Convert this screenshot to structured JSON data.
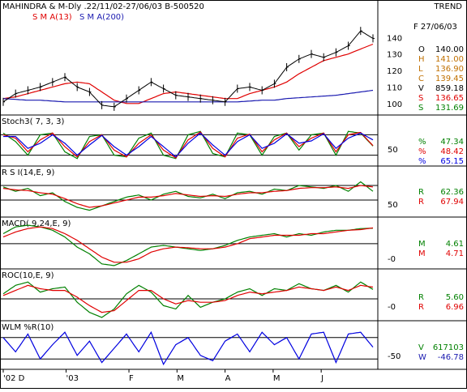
{
  "header": {
    "title": "MAHINDRA & M-Dly .22/11/02-27/06/03  B-500520",
    "mode": "TREND",
    "sma13_label": "S M A(13)",
    "sma200_label": "S M A(200)"
  },
  "colors": {
    "price": "#000000",
    "sma13": "#e00000",
    "sma200": "#1a1ab0",
    "green": "#008000",
    "red": "#e00000",
    "blue": "#0000e0",
    "orange": "#c07000"
  },
  "price_panel": {
    "date_label": "F 27/06/03",
    "ticks": [
      "140",
      "130",
      "120",
      "110",
      "100"
    ],
    "stats": [
      {
        "key": "O",
        "value": "140.00",
        "color": "#000000"
      },
      {
        "key": "H",
        "value": "141.00",
        "color": "#c07000"
      },
      {
        "key": "L",
        "value": "136.90",
        "color": "#c07000"
      },
      {
        "key": "C",
        "value": "139.45",
        "color": "#c07000"
      },
      {
        "key": "V",
        "value": "859.18",
        "color": "#000000"
      },
      {
        "key": "S",
        "value": "136.65",
        "color": "#e00000"
      },
      {
        "key": "S",
        "value": "131.69",
        "color": "#008000"
      }
    ]
  },
  "stoch_panel": {
    "label": "Stoch3( 7, 3, 3)",
    "tick": "50",
    "values": [
      {
        "key": "%",
        "value": "47.34",
        "color": "#008000"
      },
      {
        "key": "%",
        "value": "48.42",
        "color": "#e00000"
      },
      {
        "key": "%",
        "value": "65.15",
        "color": "#0000e0"
      }
    ]
  },
  "rsi_panel": {
    "label": "R S I(14,E, 9)",
    "tick": "50",
    "values": [
      {
        "key": "R",
        "value": "62.36",
        "color": "#008000"
      },
      {
        "key": "R",
        "value": "67.94",
        "color": "#e00000"
      }
    ]
  },
  "macd_panel": {
    "label": "MACD( 9,24,E, 9)",
    "tick": "-0",
    "values": [
      {
        "key": "M",
        "value": "4.61",
        "color": "#008000"
      },
      {
        "key": "M",
        "value": "4.71",
        "color": "#e00000"
      }
    ]
  },
  "roc_panel": {
    "label": "ROC(10,E, 9)",
    "tick": "-0",
    "values": [
      {
        "key": "R",
        "value": "5.60",
        "color": "#008000"
      },
      {
        "key": "R",
        "value": "6.96",
        "color": "#e00000"
      }
    ]
  },
  "wlm_panel": {
    "label": "WLM %R(10)",
    "tick": "-50",
    "values": [
      {
        "key": "V",
        "value": "617103",
        "color": "#008000"
      },
      {
        "key": "W",
        "value": "-46.78",
        "color": "#1a1ab0"
      }
    ]
  },
  "x_axis": [
    "'02 D",
    "'03",
    "F",
    "M",
    "A",
    "M",
    "J"
  ],
  "chart_data": [
    {
      "type": "line",
      "panel": "price",
      "x_range": [
        "22/11/02",
        "27/06/03"
      ],
      "ylim": [
        95,
        148
      ],
      "series": [
        {
          "name": "S M A(13)",
          "color": "#e00000",
          "values": [
            103,
            104,
            106,
            108,
            110,
            112,
            113,
            112,
            107,
            102,
            100,
            100,
            103,
            106,
            107,
            106,
            105,
            104,
            103,
            103,
            106,
            108,
            110,
            113,
            118,
            122,
            126,
            128,
            130,
            133,
            136
          ]
        },
        {
          "name": "S M A(200)",
          "color": "#1a1ab0",
          "values": [
            103,
            102.5,
            102,
            102,
            101.5,
            101,
            101,
            101,
            101,
            101,
            101,
            101,
            101,
            101,
            101,
            101,
            101,
            101,
            101,
            101,
            101.5,
            102,
            102,
            103,
            103.5,
            104,
            104.5,
            105,
            106,
            107,
            108
          ]
        },
        {
          "name": "close",
          "color": "#000000",
          "values": [
            101,
            106,
            108,
            110,
            113,
            116,
            110,
            107,
            99,
            98,
            103,
            108,
            113,
            109,
            105,
            104,
            103,
            102,
            101,
            109,
            110,
            108,
            112,
            122,
            127,
            130,
            128,
            131,
            135,
            144,
            139.45
          ]
        }
      ]
    },
    {
      "type": "line",
      "panel": "stoch",
      "ylim": [
        0,
        100
      ],
      "series": [
        {
          "name": "",
          "color": "#008000",
          "values": [
            85,
            60,
            20,
            80,
            85,
            30,
            10,
            75,
            80,
            20,
            15,
            70,
            85,
            20,
            10,
            80,
            90,
            25,
            15,
            85,
            80,
            20,
            75,
            85,
            35,
            80,
            85,
            20,
            90,
            85,
            47
          ]
        },
        {
          "name": "",
          "color": "#e00000",
          "values": [
            80,
            70,
            30,
            65,
            85,
            45,
            15,
            60,
            80,
            35,
            15,
            55,
            80,
            35,
            12,
            65,
            88,
            40,
            15,
            70,
            82,
            30,
            65,
            85,
            45,
            70,
            85,
            30,
            80,
            87,
            48
          ]
        },
        {
          "name": "",
          "color": "#0000e0",
          "values": [
            75,
            75,
            40,
            55,
            80,
            55,
            20,
            50,
            78,
            45,
            20,
            45,
            75,
            45,
            15,
            55,
            85,
            50,
            20,
            60,
            80,
            40,
            55,
            83,
            55,
            62,
            83,
            40,
            70,
            85,
            65
          ]
        }
      ]
    },
    {
      "type": "line",
      "panel": "rsi",
      "ylim": [
        30,
        80
      ],
      "series": [
        {
          "name": "",
          "color": "#008000",
          "values": [
            68,
            62,
            66,
            56,
            60,
            48,
            40,
            36,
            42,
            48,
            54,
            57,
            50,
            58,
            62,
            55,
            53,
            58,
            52,
            60,
            62,
            58,
            65,
            63,
            70,
            68,
            66,
            70,
            62,
            75,
            62
          ]
        },
        {
          "name": "",
          "color": "#e00000",
          "values": [
            66,
            64,
            63,
            60,
            58,
            52,
            45,
            40,
            42,
            46,
            50,
            54,
            54,
            56,
            59,
            57,
            55,
            56,
            55,
            58,
            60,
            60,
            62,
            63,
            66,
            67,
            67,
            68,
            66,
            70,
            68
          ]
        }
      ]
    },
    {
      "type": "line",
      "panel": "macd",
      "ylim": [
        -7,
        6
      ],
      "series": [
        {
          "name": "",
          "color": "#008000",
          "values": [
            3,
            5,
            5.5,
            5,
            4,
            2,
            -1,
            -3,
            -6,
            -6.5,
            -5,
            -3,
            -1,
            -0.5,
            -1,
            -1.5,
            -2,
            -1.5,
            -0.5,
            1,
            2,
            2.5,
            3,
            2,
            3,
            2.5,
            3.5,
            4,
            4,
            4.5,
            4.61
          ]
        },
        {
          "name": "",
          "color": "#e00000",
          "values": [
            2,
            3.5,
            4.5,
            5,
            4.5,
            3,
            1,
            -1.5,
            -4,
            -5.5,
            -5.5,
            -4.5,
            -2.5,
            -1.5,
            -1,
            -1.2,
            -1.5,
            -1.5,
            -1,
            0,
            1.5,
            2,
            2.5,
            2.5,
            2.5,
            3,
            3,
            3.5,
            4,
            4.2,
            4.71
          ]
        }
      ]
    },
    {
      "type": "line",
      "panel": "roc",
      "ylim": [
        -12,
        12
      ],
      "series": [
        {
          "name": "",
          "color": "#008000",
          "values": [
            3,
            8,
            10,
            4,
            6,
            7,
            -2,
            -8,
            -11,
            -6,
            3,
            8,
            4,
            -4,
            -6,
            2,
            -5,
            -2,
            0,
            4,
            6,
            2,
            6,
            5,
            9,
            6,
            5,
            8,
            4,
            10,
            5.6
          ]
        },
        {
          "name": "",
          "color": "#e00000",
          "values": [
            2,
            5,
            8,
            6,
            5,
            5,
            1,
            -4,
            -8,
            -7,
            -1,
            5,
            5,
            0,
            -3,
            -1,
            -2,
            -2,
            -1,
            2,
            4,
            3,
            4,
            5,
            7,
            6,
            5,
            7,
            5,
            8,
            6.96
          ]
        }
      ]
    },
    {
      "type": "line",
      "panel": "wlm",
      "ylim": [
        -100,
        0
      ],
      "series": [
        {
          "name": "",
          "color": "#0000e0",
          "values": [
            -20,
            -60,
            -10,
            -80,
            -40,
            -5,
            -70,
            -30,
            -90,
            -50,
            -10,
            -60,
            -5,
            -95,
            -40,
            -20,
            -70,
            -85,
            -30,
            -10,
            -60,
            -5,
            -40,
            -20,
            -80,
            -10,
            -5,
            -90,
            -10,
            -5,
            -46.78
          ]
        }
      ]
    }
  ]
}
